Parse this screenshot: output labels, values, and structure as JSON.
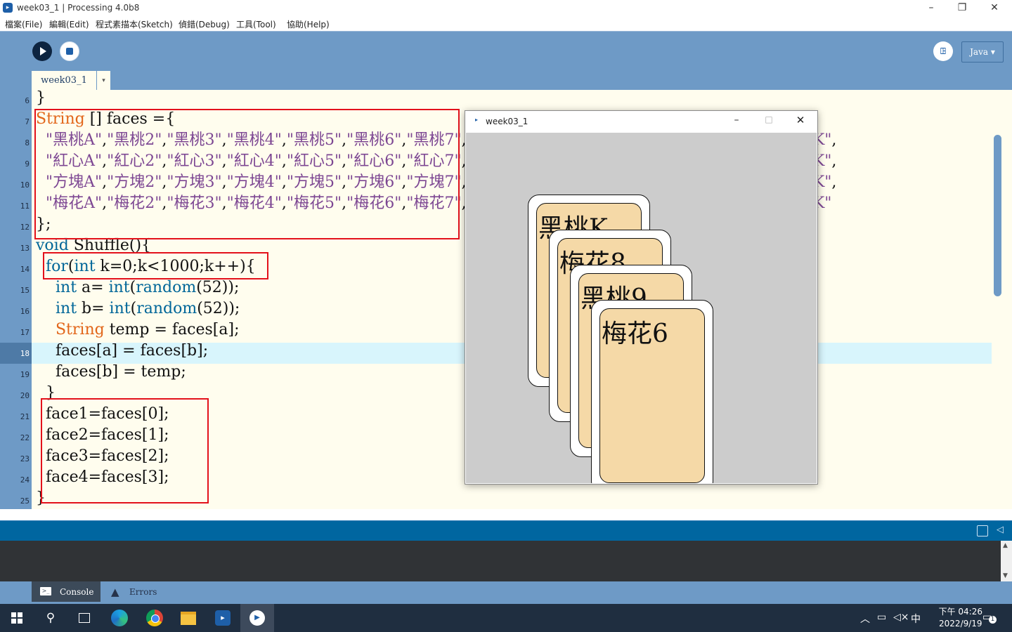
{
  "window": {
    "title": "week03_1 | Processing 4.0b8"
  },
  "menu": [
    "檔案(File)",
    "編輯(Edit)",
    "程式素描本(Sketch)",
    "偵錯(Debug)",
    "工具(Tool)",
    "協助(Help)"
  ],
  "toolbar": {
    "mode": "Java ▾",
    "debug_glyph": "ꖸ"
  },
  "tab": {
    "name": "week03_1",
    "menu_glyph": "▾"
  },
  "code": {
    "lines": [
      6,
      7,
      8,
      9,
      10,
      11,
      12,
      13,
      14,
      15,
      16,
      17,
      18,
      19,
      20,
      21,
      22,
      23,
      24,
      25
    ],
    "current_line": 18
  },
  "console": {
    "console_label": "Console",
    "errors_label": "Errors"
  },
  "sketch": {
    "title": "week03_1",
    "cards": [
      "黑桃K",
      "梅花8",
      "黑桃9",
      "梅花6"
    ]
  },
  "taskbar": {
    "time": "下午 04:26",
    "date": "2022/9/19",
    "ime": "中",
    "notification_count": "1"
  }
}
